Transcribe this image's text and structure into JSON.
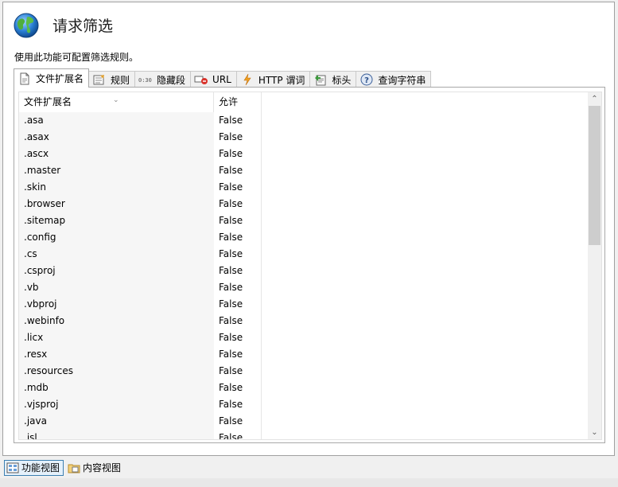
{
  "header": {
    "title": "请求筛选",
    "description": "使用此功能可配置筛选规则。",
    "icon": "globe-filter-icon"
  },
  "tabs": [
    {
      "label": "文件扩展名",
      "icon": "document-icon",
      "active": true
    },
    {
      "label": "规则",
      "icon": "rules-icon",
      "active": false
    },
    {
      "label": "隐藏段",
      "icon": "hidden-segment-icon",
      "active": false
    },
    {
      "label": "URL",
      "icon": "url-deny-icon",
      "active": false
    },
    {
      "label": "HTTP 谓词",
      "icon": "lightning-icon",
      "active": false
    },
    {
      "label": "标头",
      "icon": "headers-icon",
      "active": false
    },
    {
      "label": "查询字符串",
      "icon": "help-question-icon",
      "active": false
    }
  ],
  "table": {
    "columns": [
      "文件扩展名",
      "允许"
    ],
    "rows": [
      [
        ".asa",
        "False"
      ],
      [
        ".asax",
        "False"
      ],
      [
        ".ascx",
        "False"
      ],
      [
        ".master",
        "False"
      ],
      [
        ".skin",
        "False"
      ],
      [
        ".browser",
        "False"
      ],
      [
        ".sitemap",
        "False"
      ],
      [
        ".config",
        "False"
      ],
      [
        ".cs",
        "False"
      ],
      [
        ".csproj",
        "False"
      ],
      [
        ".vb",
        "False"
      ],
      [
        ".vbproj",
        "False"
      ],
      [
        ".webinfo",
        "False"
      ],
      [
        ".licx",
        "False"
      ],
      [
        ".resx",
        "False"
      ],
      [
        ".resources",
        "False"
      ],
      [
        ".mdb",
        "False"
      ],
      [
        ".vjsproj",
        "False"
      ],
      [
        ".java",
        "False"
      ],
      [
        ".jsl",
        "False"
      ]
    ]
  },
  "bottom_views": [
    {
      "label": "功能视图",
      "icon": "feature-view-icon",
      "active": true
    },
    {
      "label": "内容视图",
      "icon": "content-view-icon",
      "active": false
    }
  ],
  "colors": {
    "accent": "#3c7fb1",
    "border": "#a8a8a8"
  }
}
